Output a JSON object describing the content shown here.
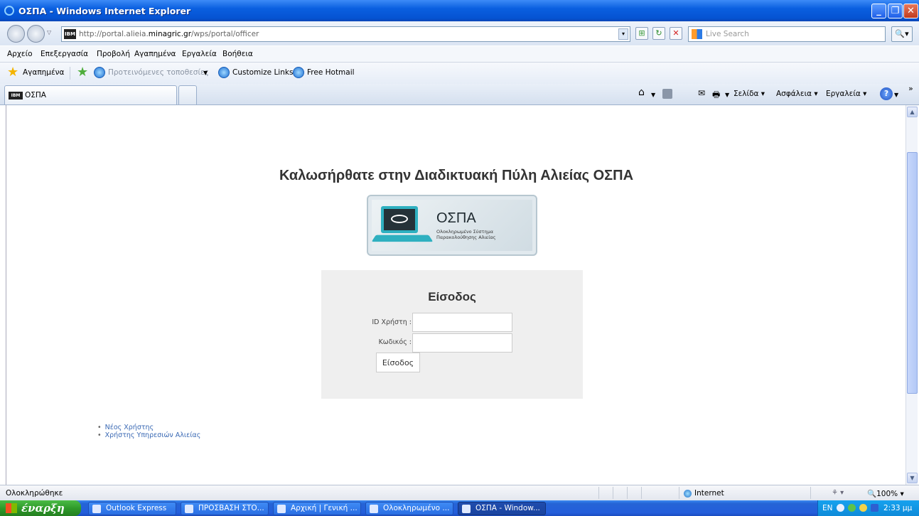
{
  "window": {
    "title": "ΟΣΠΑ - Windows Internet Explorer"
  },
  "address": {
    "url_prefix": "http://portal.alieia.",
    "url_domain": "minagric.gr",
    "url_path": "/wps/portal/officer",
    "search_placeholder": "Live Search"
  },
  "menu": [
    "Αρχείο",
    "Επεξεργασία",
    "Προβολή",
    "Αγαπημένα",
    "Εργαλεία",
    "Βοήθεια"
  ],
  "favorites": {
    "label": "Αγαπημένα",
    "suggested": "Προτεινόμενες τοποθεσίες",
    "customize": "Customize Links",
    "hotmail": "Free Hotmail"
  },
  "tab": {
    "label": "ΟΣΠΑ",
    "favicon_text": "IBM"
  },
  "commandbar": {
    "page": "Σελίδα",
    "safety": "Ασφάλεια",
    "tools": "Εργαλεία"
  },
  "page": {
    "heading": "Καλωσήρθατε στην Διαδικτυακή Πύλη Αλιείας ΟΣΠΑ",
    "logo": {
      "name": "ΟΣΠΑ",
      "subtitle_line1": "Ολοκληρωμένο Σύστημα",
      "subtitle_line2": "Παρακολούθησης Αλιείας"
    },
    "login": {
      "title": "Είσοδος",
      "user_label": "ID Χρήστη :",
      "pass_label": "Κωδικός  :",
      "button": "Είσοδος"
    },
    "links": [
      "Νέος Χρήστης",
      "Χρήστης Υπηρεσιών Αλιείας"
    ]
  },
  "status": {
    "text": "Ολοκληρώθηκε",
    "zone": "Internet",
    "zoom": "100%"
  },
  "taskbar": {
    "start": "έναρξη",
    "tasks": [
      "Outlook Express",
      "ΠΡΟΣΒΑΣΗ ΣΤΟ...",
      "Αρχική | Γενική ...",
      "Ολοκληρωμένο ...",
      "ΟΣΠΑ - Window..."
    ],
    "lang": "EN",
    "clock": "2:33 μμ"
  }
}
